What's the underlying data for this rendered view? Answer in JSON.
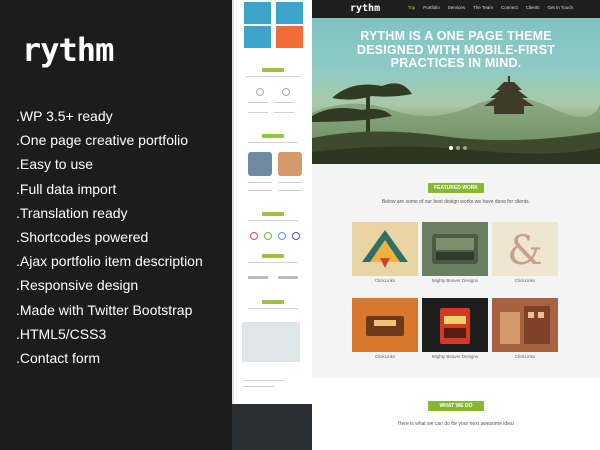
{
  "brand": "rythm",
  "features": [
    ".WP 3.5+ ready",
    ".One page creative portfolio",
    ".Easy to use",
    ".Full data import",
    ".Translation ready",
    ".Shortcodes powered",
    ".Ajax portfolio item description",
    ".Responsive design",
    ".Made with Twitter Bootstrap",
    ".HTML5/CSS3",
    ".Contact form"
  ],
  "site": {
    "logo": "rythm",
    "nav": [
      "Top",
      "Portfolio",
      "Services",
      "The Team",
      "Connect",
      "Clients",
      "Get In Touch"
    ],
    "nav_active": "Top",
    "hero_title_line1": "RYTHM IS A ONE PAGE THEME",
    "hero_title_line2": "DESIGNED WITH MOBILE-FIRST",
    "hero_title_line3": "PRACTICES IN MIND.",
    "featured_label": "FEATURED WORK",
    "featured_sub": "Below are some of our best design works we have done for clients.",
    "works": [
      {
        "caption": "ClickLinks"
      },
      {
        "caption": "Mighty Beaver Designs"
      },
      {
        "caption": "ClickLinks"
      },
      {
        "caption": "ClickLinks"
      },
      {
        "caption": "Mighty Beaver Designs"
      },
      {
        "caption": "ClickLinks"
      }
    ],
    "whatwedo_label": "WHAT WE DO",
    "whatwedo_sub": "Here is what we can do for your next awesome idea!"
  },
  "colors": {
    "accent": "#86b832",
    "dark": "#1c1c1c",
    "nav_active": "#a7d33b"
  }
}
